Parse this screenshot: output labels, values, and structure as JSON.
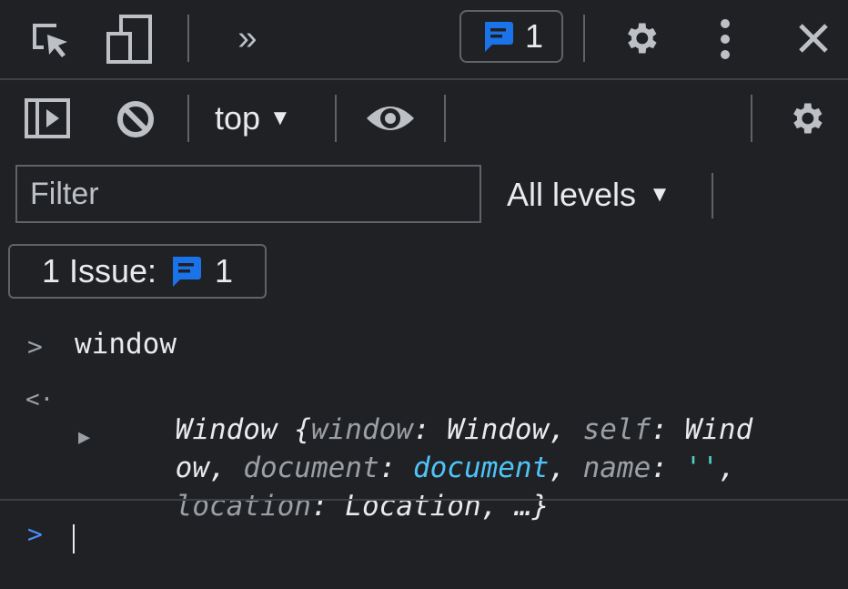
{
  "toolbar_main": {
    "more_tabs_label": "»",
    "issues_count": "1",
    "icons": [
      "inspect-icon",
      "device-toolbar-icon",
      "chevron-double-right-icon",
      "message-icon",
      "gear-icon",
      "kebab-icon",
      "close-icon"
    ]
  },
  "console_toolbar": {
    "context_label": "top",
    "context_caret": "▼",
    "icons": [
      "sidebar-toggle-icon",
      "clear-console-icon",
      "eye-icon",
      "gear-icon"
    ]
  },
  "filter": {
    "placeholder": "Filter",
    "levels_label": "All levels",
    "levels_caret": "▼"
  },
  "issues_bar": {
    "label": "1 Issue:",
    "count": "1"
  },
  "console": {
    "input_prompt": ">",
    "input_text": "window",
    "result_prompt": "<·",
    "expand_arrow": "▶",
    "result_line1": {
      "t1": "Window {",
      "k1": "window",
      "s1": ": ",
      "v1": "Window",
      "c1": ", ",
      "k2": "self",
      "s2": ": ",
      "v2": "Wind"
    },
    "result_line2": {
      "v2b": "ow",
      "c2": ", ",
      "k3": "document",
      "s3": ": ",
      "v3": "document",
      "c3": ", ",
      "k4": "name",
      "s4": ": ",
      "v4": "''",
      "c4": ","
    },
    "result_line3": {
      "k5": "location",
      "s5": ": ",
      "v5": "Location",
      "c5": ", …}"
    },
    "active_prompt": ">"
  },
  "colors": {
    "background": "#202124",
    "text": "#e8eaed",
    "muted": "#9aa0a6",
    "accent_blue": "#1a73e8",
    "link_blue": "#4fc3f7",
    "string_teal": "#4dd0c4"
  }
}
